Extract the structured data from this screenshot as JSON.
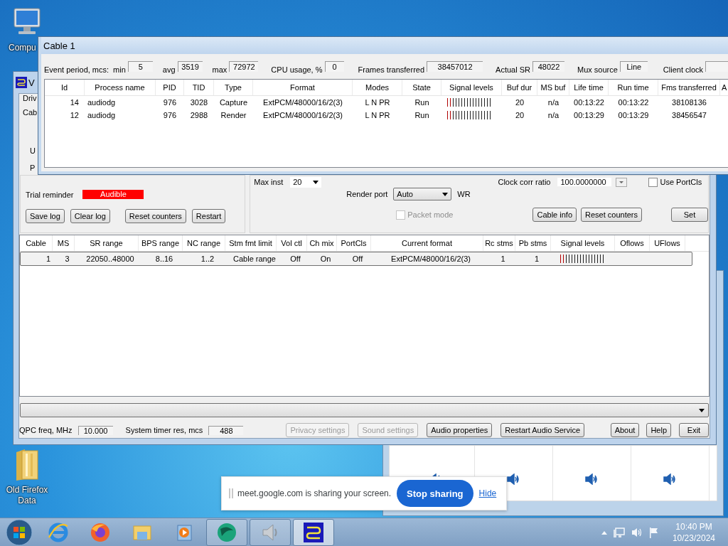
{
  "desktop_icons": [
    {
      "kind": "computer",
      "label": "Compu"
    },
    {
      "kind": "folder",
      "label": "Old Firefox Data"
    }
  ],
  "main_window": {
    "title": "V",
    "fragments": [
      "Driv",
      "Cab",
      "U",
      "P"
    ],
    "trial_reminder": {
      "label": "Trial reminder",
      "value": "Audible"
    },
    "log_buttons": [
      "Save log",
      "Clear log",
      "Reset counters",
      "Restart"
    ],
    "max_inst": {
      "label": "Max inst",
      "value": "20"
    },
    "render_port": {
      "label": "Render port",
      "value": "Auto",
      "suffix": "WR"
    },
    "packet_mode": {
      "label": "Packet mode",
      "checked": false,
      "disabled": true
    },
    "clock_corr_ratio": {
      "label": "Clock corr ratio",
      "value": "100.0000000"
    },
    "use_portcls": {
      "label": "Use PortCls",
      "checked": false
    },
    "cable_buttons": [
      "Cable info",
      "Reset counters",
      "Set"
    ],
    "table": {
      "columns": [
        "Cable",
        "MS",
        "SR range",
        "BPS range",
        "NC range",
        "Stm fmt limit",
        "Vol ctl",
        "Ch mix",
        "PortCls",
        "Current format",
        "Rc stms",
        "Pb stms",
        "Signal levels",
        "Oflows",
        "UFlows"
      ],
      "rows": [
        {
          "selected": true,
          "cells": [
            "1",
            "3",
            "22050..48000",
            "8..16",
            "1..2",
            "Cable range",
            "Off",
            "On",
            "Off",
            "ExtPCM/48000/16/2(3)",
            "1",
            "1",
            {
              "level": 0.12
            }
          ]
        }
      ]
    },
    "qpc": {
      "label": "QPC freq, MHz",
      "value": "10.000"
    },
    "timer": {
      "label": "System timer res, mcs",
      "value": "488"
    },
    "buttons": [
      {
        "label": "Privacy settings",
        "disabled": true
      },
      {
        "label": "Sound settings",
        "disabled": true
      },
      {
        "label": "Audio properties",
        "disabled": false
      },
      {
        "label": "Restart Audio Service",
        "disabled": false
      },
      {
        "label": "About",
        "disabled": false
      },
      {
        "label": "Help",
        "disabled": false
      },
      {
        "label": "Exit",
        "disabled": false
      }
    ]
  },
  "cable_window": {
    "title": "Cable 1",
    "prefix": "Event period, mcs:",
    "stats": [
      {
        "label": "min",
        "value": "5"
      },
      {
        "label": "avg",
        "value": "3519"
      },
      {
        "label": "max",
        "value": "72972"
      },
      {
        "label": "CPU usage, %",
        "value": "0"
      },
      {
        "label": "Frames transferred",
        "value": "38457012"
      },
      {
        "label": "Actual SR",
        "value": "48022"
      },
      {
        "label": "Mux source",
        "value": "Line"
      },
      {
        "label": "Client clock"
      }
    ],
    "table": {
      "columns": [
        "Id",
        "Process name",
        "PID",
        "TID",
        "Type",
        "Format",
        "Modes",
        "State",
        "Signal levels",
        "Buf dur",
        "MS buf",
        "Life time",
        "Run time",
        "Fms transferred",
        "A"
      ],
      "rows": [
        {
          "cells": [
            "14",
            "audiodg",
            "976",
            "3028",
            "Capture",
            "ExtPCM/48000/16/2(3)",
            "L N PR",
            "Run",
            {
              "level": 0.12
            },
            "20",
            "n/a",
            "00:13:22",
            "00:13:22",
            "38108136"
          ]
        },
        {
          "cells": [
            "12",
            "audiodg",
            "976",
            "2988",
            "Render",
            "ExtPCM/48000/16/2(3)",
            "L N PR",
            "Run",
            {
              "level": 0.12
            },
            "20",
            "n/a",
            "00:13:29",
            "00:13:29",
            "38456547"
          ]
        }
      ]
    }
  },
  "sound_window": {
    "tiles": [
      {
        "kind": "speaker"
      },
      {
        "kind": "speaker"
      },
      {
        "kind": "speaker"
      },
      {
        "kind": "speaker"
      }
    ]
  },
  "share_bar": {
    "message": "meet.google.com is sharing your screen.",
    "stop_button": "Stop sharing",
    "hide_link": "Hide"
  },
  "taskbar": {
    "apps": [
      {
        "kind": "browser-e",
        "running": false,
        "selected": false
      },
      {
        "kind": "fox",
        "running": false,
        "selected": false
      },
      {
        "kind": "folder",
        "running": false,
        "selected": false
      },
      {
        "kind": "media",
        "running": false,
        "selected": false
      },
      {
        "kind": "globe",
        "running": true,
        "selected": false
      },
      {
        "kind": "speaker",
        "running": true,
        "selected": false
      },
      {
        "kind": "cable",
        "running": true,
        "selected": true
      }
    ],
    "time": "10:40 PM",
    "date": "10/23/2024"
  }
}
